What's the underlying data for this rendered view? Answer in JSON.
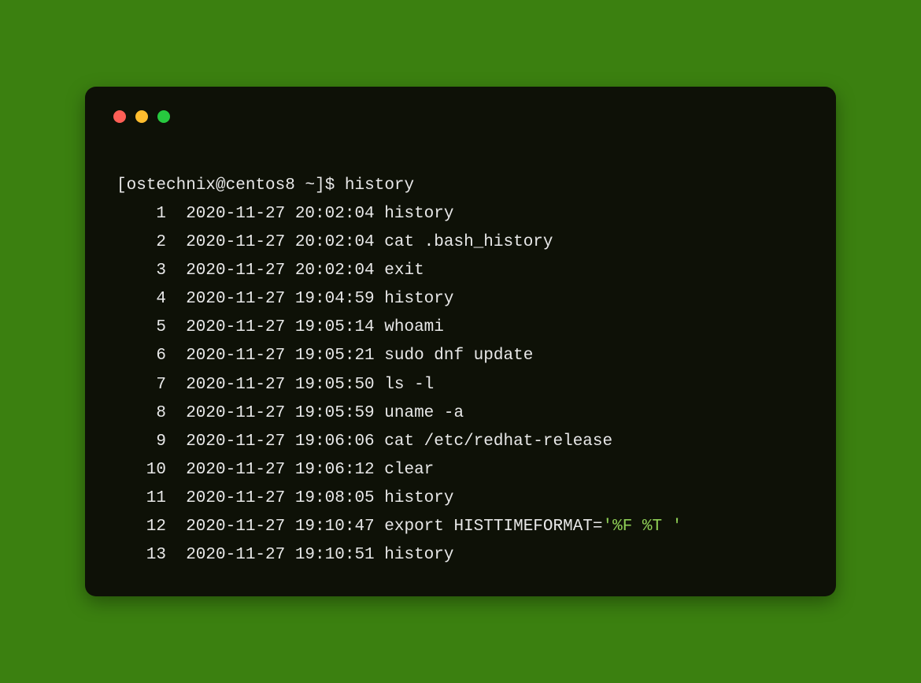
{
  "prompt": {
    "user": "ostechnix",
    "host": "centos8",
    "path": "~",
    "symbol": "$",
    "command": "history"
  },
  "history": [
    {
      "n": "1",
      "ts": "2020-11-27 20:02:04",
      "cmd": "history"
    },
    {
      "n": "2",
      "ts": "2020-11-27 20:02:04",
      "cmd": "cat .bash_history"
    },
    {
      "n": "3",
      "ts": "2020-11-27 20:02:04",
      "cmd": "exit"
    },
    {
      "n": "4",
      "ts": "2020-11-27 19:04:59",
      "cmd": "history"
    },
    {
      "n": "5",
      "ts": "2020-11-27 19:05:14",
      "cmd": "whoami"
    },
    {
      "n": "6",
      "ts": "2020-11-27 19:05:21",
      "cmd": "sudo dnf update"
    },
    {
      "n": "7",
      "ts": "2020-11-27 19:05:50",
      "cmd": "ls -l"
    },
    {
      "n": "8",
      "ts": "2020-11-27 19:05:59",
      "cmd": "uname -a"
    },
    {
      "n": "9",
      "ts": "2020-11-27 19:06:06",
      "cmd": "cat /etc/redhat-release"
    },
    {
      "n": "10",
      "ts": "2020-11-27 19:06:12",
      "cmd": "clear"
    },
    {
      "n": "11",
      "ts": "2020-11-27 19:08:05",
      "cmd": "history"
    },
    {
      "n": "12",
      "ts": "2020-11-27 19:10:47",
      "cmd_prefix": "export HISTTIMEFORMAT=",
      "cmd_string": "'%F %T '"
    },
    {
      "n": "13",
      "ts": "2020-11-27 19:10:51",
      "cmd": "history"
    }
  ]
}
